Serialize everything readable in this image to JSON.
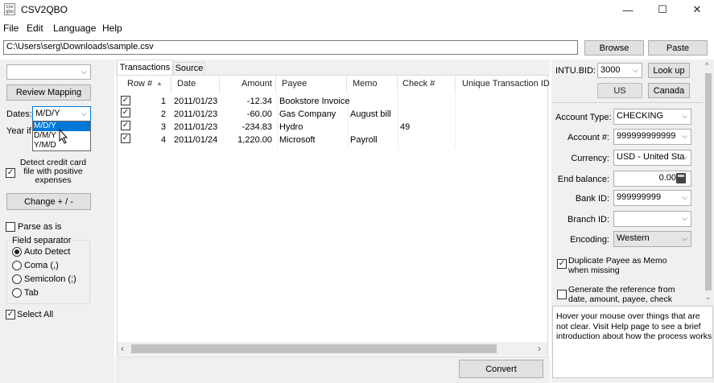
{
  "window": {
    "title": "CSV2QBO",
    "app_icon": "csv-qbo-icon",
    "controls": {
      "minimize": "—",
      "maximize": "☐",
      "close": "✕"
    }
  },
  "menu": [
    "File",
    "Edit",
    "Language",
    "Help"
  ],
  "file_path": {
    "value": "C:\\Users\\serg\\Downloads\\sample.csv"
  },
  "toolbar": {
    "browse": "Browse",
    "paste": "Paste"
  },
  "left": {
    "profile_value": "",
    "review_mapping": "Review Mapping",
    "dates_label": "Dates:",
    "dates_value": "M/D/Y",
    "dates_options": [
      "M/D/Y",
      "D/M/Y",
      "Y/M/D"
    ],
    "year_label_partial": "Year if",
    "detect_credit": "Detect credit card file with positive expenses",
    "detect_credit_checked": true,
    "change_sign": "Change + / -",
    "parse_as_is": "Parse as is",
    "parse_as_is_checked": false,
    "field_separator": "Field separator",
    "separators": [
      {
        "label": "Auto Detect",
        "selected": true
      },
      {
        "label": "Coma (,)",
        "selected": false
      },
      {
        "label": "Semicolon (;)",
        "selected": false
      },
      {
        "label": "Tab",
        "selected": false
      }
    ],
    "select_all": "Select All",
    "select_all_checked": true
  },
  "tabs": [
    "Transactions",
    "Source"
  ],
  "active_tab": "Transactions",
  "table": {
    "headers": [
      "Row #",
      "Date",
      "Amount",
      "Payee",
      "Memo",
      "Check #",
      "Unique Transaction ID"
    ],
    "rows": [
      {
        "checked": true,
        "row": "1",
        "date": "2011/01/23",
        "amount": "-12.34",
        "payee": "Bookstore Invoice",
        "memo": "",
        "check": ""
      },
      {
        "checked": true,
        "row": "2",
        "date": "2011/01/23",
        "amount": "-60.00",
        "payee": "Gas Company",
        "memo": "August bill",
        "check": ""
      },
      {
        "checked": true,
        "row": "3",
        "date": "2011/01/23",
        "amount": "-234.83",
        "payee": "Hydro",
        "memo": "",
        "check": "49"
      },
      {
        "checked": true,
        "row": "4",
        "date": "2011/01/24",
        "amount": "1,220.00",
        "payee": "Microsoft",
        "memo": "Payroll",
        "check": ""
      }
    ]
  },
  "convert": "Convert",
  "right": {
    "intu_bid_label": "INTU.BID:",
    "intu_bid_value": "3000",
    "lookup": "Look up",
    "us": "US",
    "canada": "Canada",
    "account_type_label": "Account Type:",
    "account_type_value": "CHECKING",
    "account_no_label": "Account #:",
    "account_no_value": "999999999999",
    "currency_label": "Currency:",
    "currency_value": "USD - United Sta",
    "end_balance_label": "End balance:",
    "end_balance_value": "0.00",
    "bank_id_label": "Bank ID:",
    "bank_id_value": "999999999",
    "branch_id_label": "Branch ID:",
    "branch_id_value": "",
    "encoding_label": "Encoding:",
    "encoding_value": "Western",
    "dup_payee": "Duplicate Payee as Memo when missing",
    "dup_payee_checked": true,
    "gen_ref": "Generate the reference from date, amount, payee, check",
    "gen_ref_checked": false,
    "help_text": "Hover your mouse over things that are not clear. Visit Help page to see a brief introduction about how the process works"
  }
}
